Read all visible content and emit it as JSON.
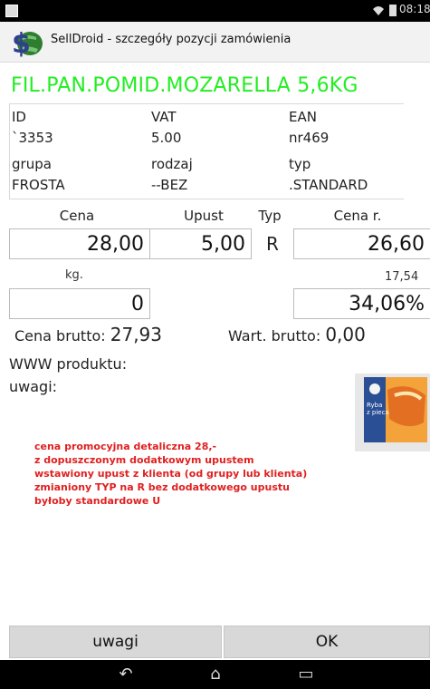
{
  "status": {
    "time": "08:18",
    "wifi_icon": "wifi-icon",
    "battery_icon": "battery-icon"
  },
  "app": {
    "title": "SellDroid - szczegóły pozycji zamówienia",
    "logo_icon": "dollar-globe-logo"
  },
  "product": {
    "name": "FIL.PAN.POMID.MOZARELLA 5,6KG",
    "id_label": "ID",
    "id_value": "`3353",
    "vat_label": "VAT",
    "vat_value": "5.00",
    "ean_label": "EAN",
    "ean_value": "nr469",
    "group_label": "grupa",
    "group_value": "FROSTA",
    "kind_label": "rodzaj",
    "kind_value": "--BEZ",
    "type_label": "typ",
    "type_value": ".STANDARD"
  },
  "pricing": {
    "price_label": "Cena",
    "discount_label": "Upust",
    "type_label": "Typ",
    "net_price_label": "Cena r.",
    "price_value": "28,00",
    "discount_value": "5,00",
    "type_value": "R",
    "net_price_value": "26,60",
    "unit_label": "kg.",
    "unit_value": "17,54",
    "quantity_value": "0",
    "margin_value": "34,06%"
  },
  "summary": {
    "gross_price_label": "Cena brutto:",
    "gross_price_value": "27,93",
    "gross_value_label": "Wart. brutto:",
    "gross_value_value": "0,00",
    "www_label": "WWW produktu:",
    "notes_label": "uwagi:"
  },
  "notes": [
    "cena promocyjna detaliczna 28,-",
    "z dopuszczonym dodatkowym upustem",
    "wstawiony upust z klienta (od grupy lub klienta)",
    "zmianiony TYP na R  bez dodatkowego upustu",
    "byłoby standardowe U"
  ],
  "buttons": {
    "notes_button": "uwagi",
    "ok_button": "OK"
  },
  "colors": {
    "product_name": "#22ee22",
    "notes_text": "#e02020"
  }
}
